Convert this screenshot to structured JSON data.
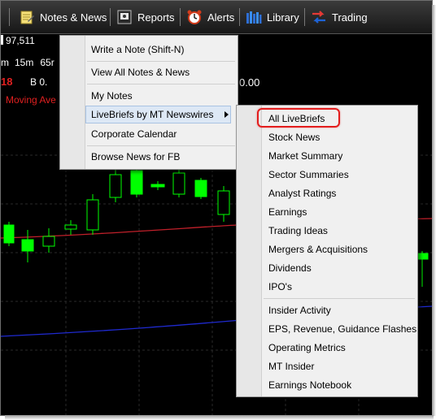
{
  "toolbar": {
    "notes_news_label": "Notes & News",
    "reports_label": "Reports",
    "alerts_label": "Alerts",
    "library_label": "Library",
    "trading_label": "Trading"
  },
  "header": {
    "price_fragment": "97,511",
    "timeframe_15m": "15m",
    "timeframe_65m_fragment": "65r",
    "date_fragment": "18",
    "b_fragment": "B 0.",
    "value_fragment": "0.00",
    "indicator_fragment": "Moving Ave"
  },
  "news_menu": {
    "items": [
      {
        "label": "Write a Note (Shift-N)"
      },
      {
        "label": "View All Notes & News"
      },
      {
        "label": "My Notes"
      },
      {
        "label": "LiveBriefs by MT Newswires"
      },
      {
        "label": "Corporate Calendar"
      },
      {
        "label": "Browse News for FB"
      }
    ]
  },
  "livebriefs_menu": {
    "items": [
      {
        "label": "All LiveBriefs"
      },
      {
        "label": "Stock News"
      },
      {
        "label": "Market Summary"
      },
      {
        "label": "Sector Summaries"
      },
      {
        "label": "Analyst Ratings"
      },
      {
        "label": "Earnings"
      },
      {
        "label": "Trading Ideas"
      },
      {
        "label": "Mergers & Acquisitions"
      },
      {
        "label": "Dividends"
      },
      {
        "label": "IPO's"
      },
      {
        "label": "Insider Activity"
      },
      {
        "label": "EPS, Revenue, Guidance Flashes"
      },
      {
        "label": "Operating Metrics"
      },
      {
        "label": "MT Insider"
      },
      {
        "label": "Earnings Notebook"
      }
    ]
  },
  "colors": {
    "candle_green": "#00ff00",
    "moving_average": "#c0202a",
    "blue_line": "#1f2ad0",
    "callout": "#e31d1d"
  }
}
